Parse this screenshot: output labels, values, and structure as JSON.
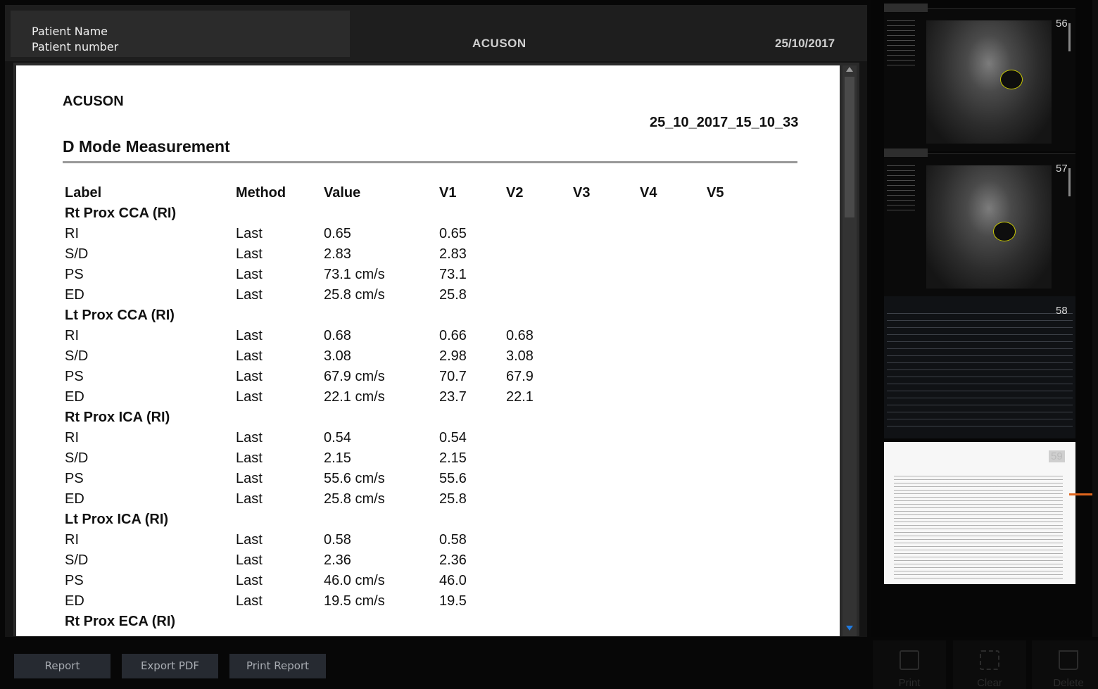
{
  "header": {
    "patient_name_label": "Patient Name",
    "patient_number_label": "Patient number",
    "brand": "ACUSON",
    "date": "25/10/2017"
  },
  "report": {
    "brand": "ACUSON",
    "timestamp": "25_10_2017_15_10_33",
    "title": "D Mode Measurement",
    "columns": [
      "Label",
      "Method",
      "Value",
      "V1",
      "V2",
      "V3",
      "V4",
      "V5"
    ],
    "rows": [
      {
        "type": "group",
        "label": "Rt Prox CCA (RI)"
      },
      {
        "type": "data",
        "label": "RI",
        "method": "Last",
        "value": "0.65",
        "v1": "0.65",
        "v2": ""
      },
      {
        "type": "data",
        "label": "S/D",
        "method": "Last",
        "value": "2.83",
        "v1": "2.83",
        "v2": ""
      },
      {
        "type": "data",
        "label": "PS",
        "method": "Last",
        "value": "73.1 cm/s",
        "v1": "73.1",
        "v2": ""
      },
      {
        "type": "data",
        "label": "ED",
        "method": "Last",
        "value": "25.8 cm/s",
        "v1": "25.8",
        "v2": ""
      },
      {
        "type": "group",
        "label": "Lt Prox CCA (RI)"
      },
      {
        "type": "data",
        "label": "RI",
        "method": "Last",
        "value": "0.68",
        "v1": "0.66",
        "v2": "0.68"
      },
      {
        "type": "data",
        "label": "S/D",
        "method": "Last",
        "value": "3.08",
        "v1": "2.98",
        "v2": "3.08"
      },
      {
        "type": "data",
        "label": "PS",
        "method": "Last",
        "value": "67.9 cm/s",
        "v1": "70.7",
        "v2": "67.9"
      },
      {
        "type": "data",
        "label": "ED",
        "method": "Last",
        "value": "22.1 cm/s",
        "v1": "23.7",
        "v2": "22.1"
      },
      {
        "type": "group",
        "label": "Rt Prox ICA (RI)"
      },
      {
        "type": "data",
        "label": "RI",
        "method": "Last",
        "value": "0.54",
        "v1": "0.54",
        "v2": ""
      },
      {
        "type": "data",
        "label": "S/D",
        "method": "Last",
        "value": "2.15",
        "v1": "2.15",
        "v2": ""
      },
      {
        "type": "data",
        "label": "PS",
        "method": "Last",
        "value": "55.6 cm/s",
        "v1": "55.6",
        "v2": ""
      },
      {
        "type": "data",
        "label": "ED",
        "method": "Last",
        "value": "25.8 cm/s",
        "v1": "25.8",
        "v2": ""
      },
      {
        "type": "group",
        "label": "Lt Prox ICA (RI)"
      },
      {
        "type": "data",
        "label": "RI",
        "method": "Last",
        "value": "0.58",
        "v1": "0.58",
        "v2": ""
      },
      {
        "type": "data",
        "label": "S/D",
        "method": "Last",
        "value": "2.36",
        "v1": "2.36",
        "v2": ""
      },
      {
        "type": "data",
        "label": "PS",
        "method": "Last",
        "value": "46.0 cm/s",
        "v1": "46.0",
        "v2": ""
      },
      {
        "type": "data",
        "label": "ED",
        "method": "Last",
        "value": "19.5 cm/s",
        "v1": "19.5",
        "v2": ""
      },
      {
        "type": "group",
        "label": "Rt Prox ECA (RI)"
      }
    ]
  },
  "buttons": {
    "report": "Report",
    "export_pdf": "Export PDF",
    "print_report": "Print Report"
  },
  "thumbnails": [
    {
      "number": "56",
      "kind": "ultrasound"
    },
    {
      "number": "57",
      "kind": "ultrasound"
    },
    {
      "number": "58",
      "kind": "table"
    },
    {
      "number": "59",
      "kind": "report",
      "selected": true
    }
  ],
  "toolbar": {
    "print": "Print",
    "clear": "Clear",
    "delete": "Delete"
  },
  "icons": {
    "scroll_up": "triangle-up-icon",
    "scroll_down": "triangle-down-icon",
    "print": "printer-icon",
    "clear": "clear-selection-icon",
    "delete": "trash-icon"
  },
  "colors": {
    "accent": "#1f7ae0",
    "selection_marker": "#e0651d"
  }
}
